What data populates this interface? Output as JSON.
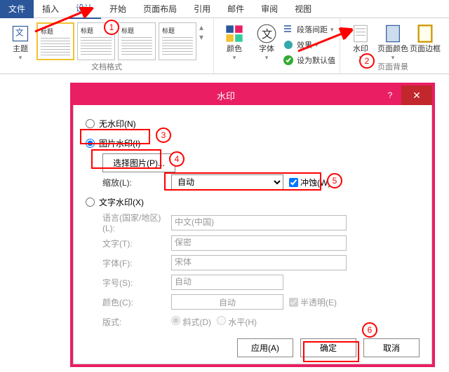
{
  "tabs": {
    "file": "文件",
    "insert": "插入",
    "design": "设计",
    "start": "开始",
    "layout": "页面布局",
    "reference": "引用",
    "mail": "邮件",
    "review": "审阅",
    "view": "视图"
  },
  "ribbon": {
    "theme": "主题",
    "thumb_title": "标题",
    "group_docfmt": "文档格式",
    "colors": "颜色",
    "fonts": "字体",
    "paragraph_spacing": "段落间距",
    "effects": "效果",
    "set_default": "设为默认值",
    "watermark": "水印",
    "page_color": "页面颜色",
    "page_border": "页面边框",
    "group_pagebg": "页面背景"
  },
  "dialog": {
    "title": "水印",
    "help": "?",
    "close": "✕",
    "opt_none": "无水印(N)",
    "opt_picture": "图片水印(I)",
    "select_picture": "选择图片(P)...",
    "scale_label": "缩放(L):",
    "scale_value": "自动",
    "washout": "冲蚀(W)",
    "opt_text": "文字水印(X)",
    "lang_label": "语言(国家/地区)(L):",
    "lang_value": "中文(中国)",
    "text_label": "文字(T):",
    "text_value": "保密",
    "font_label": "字体(F):",
    "font_value": "宋体",
    "size_label": "字号(S):",
    "size_value": "自动",
    "color_label": "颜色(C):",
    "color_value": "自动",
    "semitrans": "半透明(E)",
    "layout_label": "版式:",
    "diag": "斜式(D)",
    "horiz": "水平(H)",
    "apply": "应用(A)",
    "ok": "确定",
    "cancel": "取消"
  },
  "ann": {
    "n1": "1",
    "n2": "2",
    "n3": "3",
    "n4": "4",
    "n5": "5",
    "n6": "6"
  }
}
